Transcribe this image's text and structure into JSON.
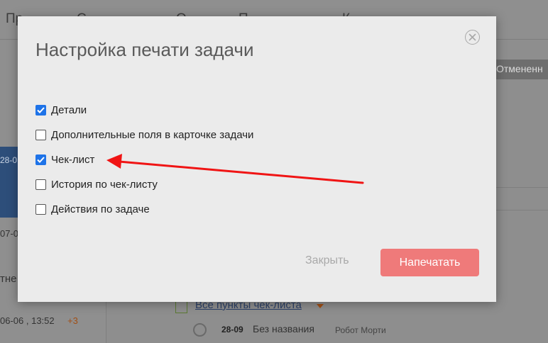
{
  "background": {
    "topbar_items": [
      "Пр",
      "С",
      "О",
      "П",
      "К"
    ],
    "tag_label": "Отмененн",
    "left_texts": [
      "28-0",
      "07-0",
      "тне",
      "06-06 , 13:52",
      "+3"
    ],
    "checklist_link": "Все пункты чек-листа",
    "row_date": "28-09",
    "row_name": "Без названия",
    "row_author": "Робот Морти"
  },
  "modal": {
    "title": "Настройка печати задачи",
    "options": [
      {
        "label": "Детали",
        "checked": true
      },
      {
        "label": "Дополнительные поля в карточке задачи",
        "checked": false
      },
      {
        "label": "Чек-лист",
        "checked": true
      },
      {
        "label": "История по чек-листу",
        "checked": false
      },
      {
        "label": "Действия по задаче",
        "checked": false
      }
    ],
    "close_label": "Закрыть",
    "print_label": "Напечатать"
  },
  "icons": {
    "close": "close-circle-icon",
    "check": "checkmark-icon",
    "annotation": "red-arrow-annotation"
  },
  "colors": {
    "checkbox_checked": "#1e73e8",
    "print_button": "#ef7a7a",
    "annotation_arrow": "#f01414"
  }
}
